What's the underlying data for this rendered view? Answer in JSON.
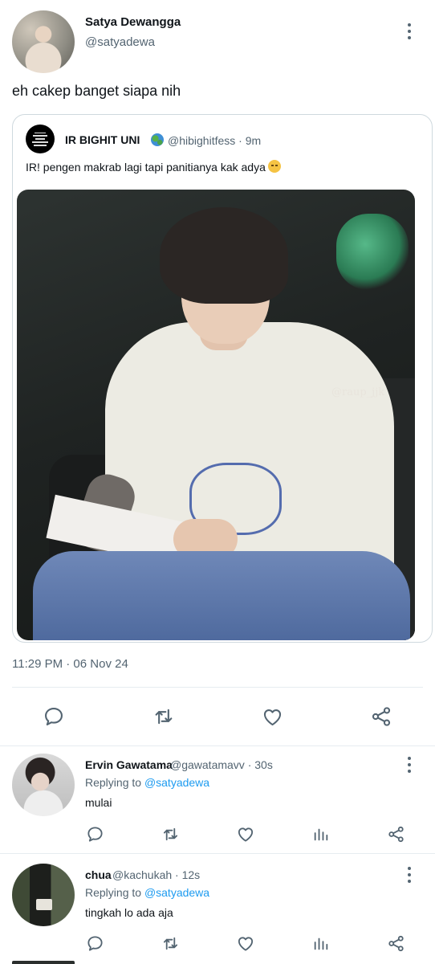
{
  "tweet": {
    "author_name": "Satya Dewangga",
    "author_handle": "@satyadewa",
    "text": "eh cakep banget siapa nih",
    "timestamp": "11:29 PM · 06 Nov 24",
    "quoted": {
      "author_name": "IR BIGHIT UNI",
      "author_handle": "@hibighitfess · 9m",
      "text": "IR! pengen makrab lagi tapi panitianya kak adya",
      "image_watermark": "@raup_jjk"
    }
  },
  "replies": [
    {
      "name": "Ervin Gawatama",
      "meta": "@gawatamavv · 30s",
      "replying_prefix": "Replying to",
      "replying_to": "@satyadewa",
      "text": "mulai"
    },
    {
      "name": "chua",
      "meta": "@kachukah · 12s",
      "replying_prefix": "Replying to",
      "replying_to": "@satyadewa",
      "text": "tingkah lo ada aja"
    }
  ],
  "icons": {
    "main_actions": [
      "reply-icon",
      "retweet-icon",
      "like-icon",
      "share-icon"
    ],
    "reply_actions": [
      "reply-icon",
      "retweet-icon",
      "like-icon",
      "views-icon",
      "share-icon"
    ],
    "more": "more-vertical-icon",
    "globe_emoji": "globe-emoji",
    "pensive_emoji": "pensive-face-emoji"
  },
  "colors": {
    "text": "#0f1419",
    "secondary": "#536471",
    "mention": "#1d9bf0",
    "border": "#cfd9de",
    "divider": "#e6ecf0"
  }
}
